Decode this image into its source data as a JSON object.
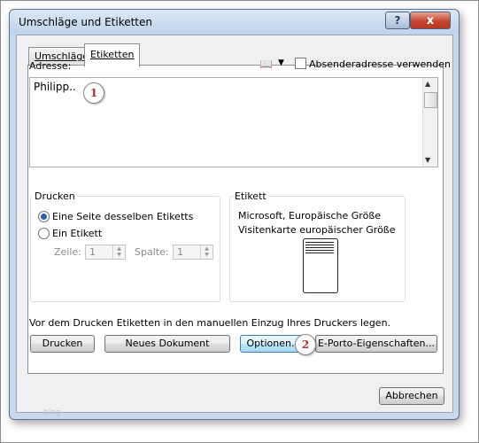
{
  "window": {
    "title": "Umschläge und Etiketten"
  },
  "titlebar": {
    "help_label": "?",
    "close_label": "x"
  },
  "tabs": [
    {
      "label": "Umschläge",
      "active": false
    },
    {
      "label": "Etiketten",
      "active": true
    }
  ],
  "address": {
    "label": "Adresse:",
    "value": "Philipp..",
    "book_icon": "address-book-icon",
    "use_sender_label": "Absenderadresse verwenden",
    "use_sender_checked": false
  },
  "print": {
    "legend": "Drucken",
    "option_full_page": "Eine Seite desselben Etiketts",
    "option_single": "Ein Etikett",
    "selected": "full_page",
    "row_label": "Zeile:",
    "row_value": "1",
    "col_label": "Spalte:",
    "col_value": "1"
  },
  "label": {
    "legend": "Etikett",
    "line1": "Microsoft, Europäische Größe",
    "line2": "Visitenkarte europäischer Größe"
  },
  "footer_text": "Vor dem Drucken Etiketten in den manuellen Einzug Ihres Druckers legen.",
  "buttons": {
    "print": "Drucken",
    "new_doc": "Neues Dokument",
    "options": "Optionen...",
    "eporto": "E-Porto-Eigenschaften...",
    "cancel": "Abbrechen"
  },
  "callouts": {
    "one": "1",
    "two": "2"
  },
  "watermark": "blog",
  "colors": {
    "accent": "#2a61b5",
    "close_red": "#c5452f",
    "callout_red": "#b03030"
  }
}
